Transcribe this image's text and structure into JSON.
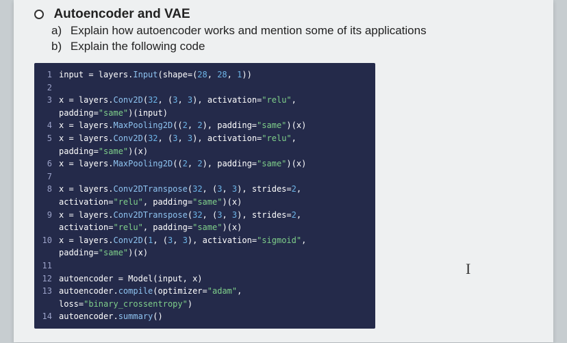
{
  "heading": {
    "title": "Autoencoder and VAE",
    "a_label": "a)",
    "a_text": "Explain how autoencoder works and mention some of its applications",
    "b_label": "b)",
    "b_text": "Explain the following code"
  },
  "code": {
    "lines": [
      {
        "n": "1",
        "text": "input = layers.Input(shape=(28, 28, 1))"
      },
      {
        "n": "2",
        "text": ""
      },
      {
        "n": "3",
        "text": "x = layers.Conv2D(32, (3, 3), activation=\"relu\","
      },
      {
        "n": "",
        "text": "padding=\"same\")(input)"
      },
      {
        "n": "4",
        "text": "x = layers.MaxPooling2D((2, 2), padding=\"same\")(x)"
      },
      {
        "n": "5",
        "text": "x = layers.Conv2D(32, (3, 3), activation=\"relu\","
      },
      {
        "n": "",
        "text": "padding=\"same\")(x)"
      },
      {
        "n": "6",
        "text": "x = layers.MaxPooling2D((2, 2), padding=\"same\")(x)"
      },
      {
        "n": "7",
        "text": ""
      },
      {
        "n": "8",
        "text": "x = layers.Conv2DTranspose(32, (3, 3), strides=2,"
      },
      {
        "n": "",
        "text": "activation=\"relu\", padding=\"same\")(x)"
      },
      {
        "n": "9",
        "text": "x = layers.Conv2DTranspose(32, (3, 3), strides=2,"
      },
      {
        "n": "",
        "text": "activation=\"relu\", padding=\"same\")(x)"
      },
      {
        "n": "10",
        "text": "x = layers.Conv2D(1, (3, 3), activation=\"sigmoid\","
      },
      {
        "n": "",
        "text": "padding=\"same\")(x)"
      },
      {
        "n": "11",
        "text": ""
      },
      {
        "n": "12",
        "text": "autoencoder = Model(input, x)"
      },
      {
        "n": "13",
        "text": "autoencoder.compile(optimizer=\"adam\","
      },
      {
        "n": "",
        "text": "loss=\"binary_crossentropy\")"
      },
      {
        "n": "14",
        "text": "autoencoder.summary()"
      }
    ]
  },
  "cursor": "I"
}
